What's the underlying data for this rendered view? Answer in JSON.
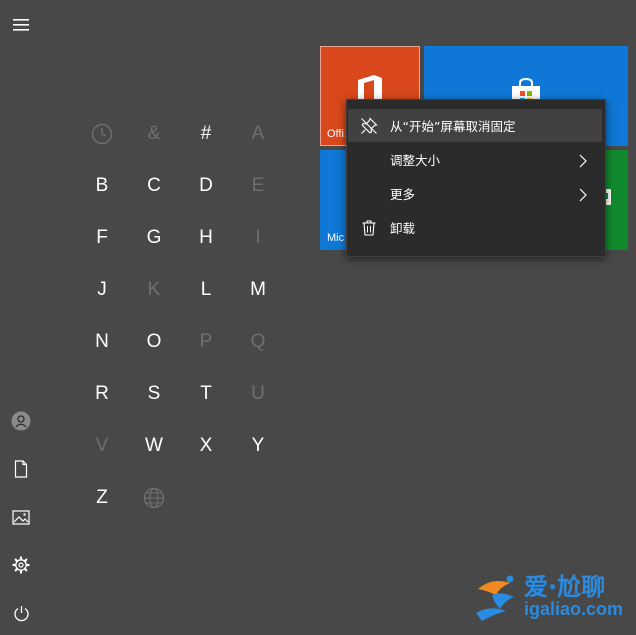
{
  "letters": [
    {
      "text": "",
      "icon": "clock-icon",
      "dim": true
    },
    {
      "text": "&",
      "dim": true
    },
    {
      "text": "#",
      "dim": false
    },
    {
      "text": "A",
      "dim": true
    },
    {
      "text": "B",
      "dim": false
    },
    {
      "text": "C",
      "dim": false
    },
    {
      "text": "D",
      "dim": false
    },
    {
      "text": "E",
      "dim": true
    },
    {
      "text": "F",
      "dim": false
    },
    {
      "text": "G",
      "dim": false
    },
    {
      "text": "H",
      "dim": false
    },
    {
      "text": "I",
      "dim": true
    },
    {
      "text": "J",
      "dim": false
    },
    {
      "text": "K",
      "dim": true
    },
    {
      "text": "L",
      "dim": false
    },
    {
      "text": "M",
      "dim": false
    },
    {
      "text": "N",
      "dim": false
    },
    {
      "text": "O",
      "dim": false
    },
    {
      "text": "P",
      "dim": true
    },
    {
      "text": "Q",
      "dim": true
    },
    {
      "text": "R",
      "dim": false
    },
    {
      "text": "S",
      "dim": false
    },
    {
      "text": "T",
      "dim": false
    },
    {
      "text": "U",
      "dim": true
    },
    {
      "text": "V",
      "dim": true
    },
    {
      "text": "W",
      "dim": false
    },
    {
      "text": "X",
      "dim": false
    },
    {
      "text": "Y",
      "dim": false
    },
    {
      "text": "Z",
      "dim": false
    },
    {
      "text": "",
      "icon": "globe-icon",
      "dim": true
    }
  ],
  "tiles": {
    "office": {
      "label": "Offi",
      "color": "#d9481c",
      "icon": "office-logo-icon"
    },
    "store": {
      "label": "",
      "color": "#0f78d7",
      "icon": "store-bag-icon"
    },
    "mail": {
      "label": "Mic",
      "color": "#0f78d7"
    },
    "green": {
      "label": "",
      "color": "#118a2d"
    }
  },
  "context_menu": {
    "items": [
      {
        "label": "从“开始”屏幕取消固定",
        "icon": "unpin-icon"
      },
      {
        "label": "调整大小",
        "submenu": true
      },
      {
        "label": "更多",
        "submenu": true
      },
      {
        "label": "卸载",
        "icon": "trash-icon"
      }
    ]
  },
  "watermark": {
    "text": "爱·尬聊",
    "url": "igaliao.com"
  },
  "colors": {
    "background": "#484848",
    "menu_bg": "#2b2b2b",
    "menu_hover": "#414141",
    "dim_letter": "#6f6f6f"
  }
}
